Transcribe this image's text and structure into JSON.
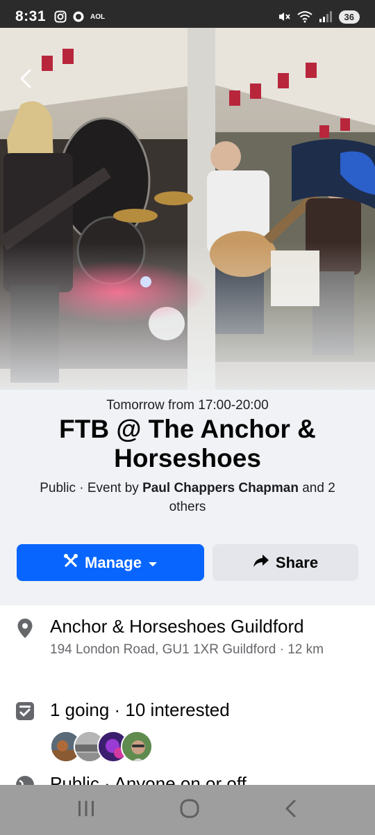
{
  "status_bar": {
    "time": "8:31",
    "carrier_label": "AOL",
    "battery": "36",
    "icons": [
      "instagram-icon",
      "whatsapp-icon",
      "aol-icon",
      "mute-icon",
      "wifi-icon",
      "signal-icon",
      "battery-icon"
    ]
  },
  "event": {
    "time": "Tomorrow from 17:00-20:00",
    "title": "FTB @ The Anchor & Horseshoes",
    "meta_prefix": "Public · Event by ",
    "host": "Paul Chappers Chapman",
    "meta_suffix": " and 2 others"
  },
  "actions": {
    "manage_label": "Manage",
    "share_label": "Share"
  },
  "details": {
    "location_name": "Anchor & Horseshoes Guildford",
    "location_address": "194 London Road, GU1 1XR Guildford · 12 km",
    "attendance": "1 going · 10 interested",
    "privacy": "Public · Anyone on or off"
  },
  "colors": {
    "primary": "#0866ff",
    "secondary_button": "#e4e6eb",
    "header_background": "#f0f2f5",
    "nav_bar": "#9e9e9e"
  }
}
